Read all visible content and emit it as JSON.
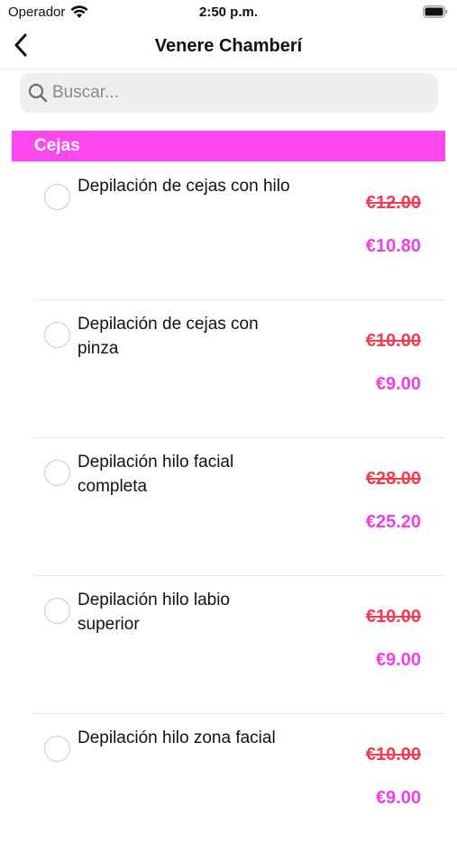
{
  "status_bar": {
    "carrier": "Operador",
    "time": "2:50 p.m."
  },
  "nav": {
    "title": "Venere Chamberí"
  },
  "search": {
    "placeholder": "Buscar..."
  },
  "section": {
    "title": "Cejas",
    "color": "#ff47f0"
  },
  "colors": {
    "old_price": "#f43a4e",
    "new_price": "#ee3fe6"
  },
  "services": [
    {
      "name": "Depilación de cejas con hilo",
      "old_price": "€12.00",
      "new_price": "€10.80"
    },
    {
      "name": "Depilación de cejas con pinza",
      "old_price": "€10.00",
      "new_price": "€9.00"
    },
    {
      "name": "Depilación hilo facial completa",
      "old_price": "€28.00",
      "new_price": "€25.20"
    },
    {
      "name": "Depilación hilo labio superior",
      "old_price": "€10.00",
      "new_price": "€9.00"
    },
    {
      "name": "Depilación hilo zona facial",
      "old_price": "€10.00",
      "new_price": "€9.00"
    }
  ]
}
